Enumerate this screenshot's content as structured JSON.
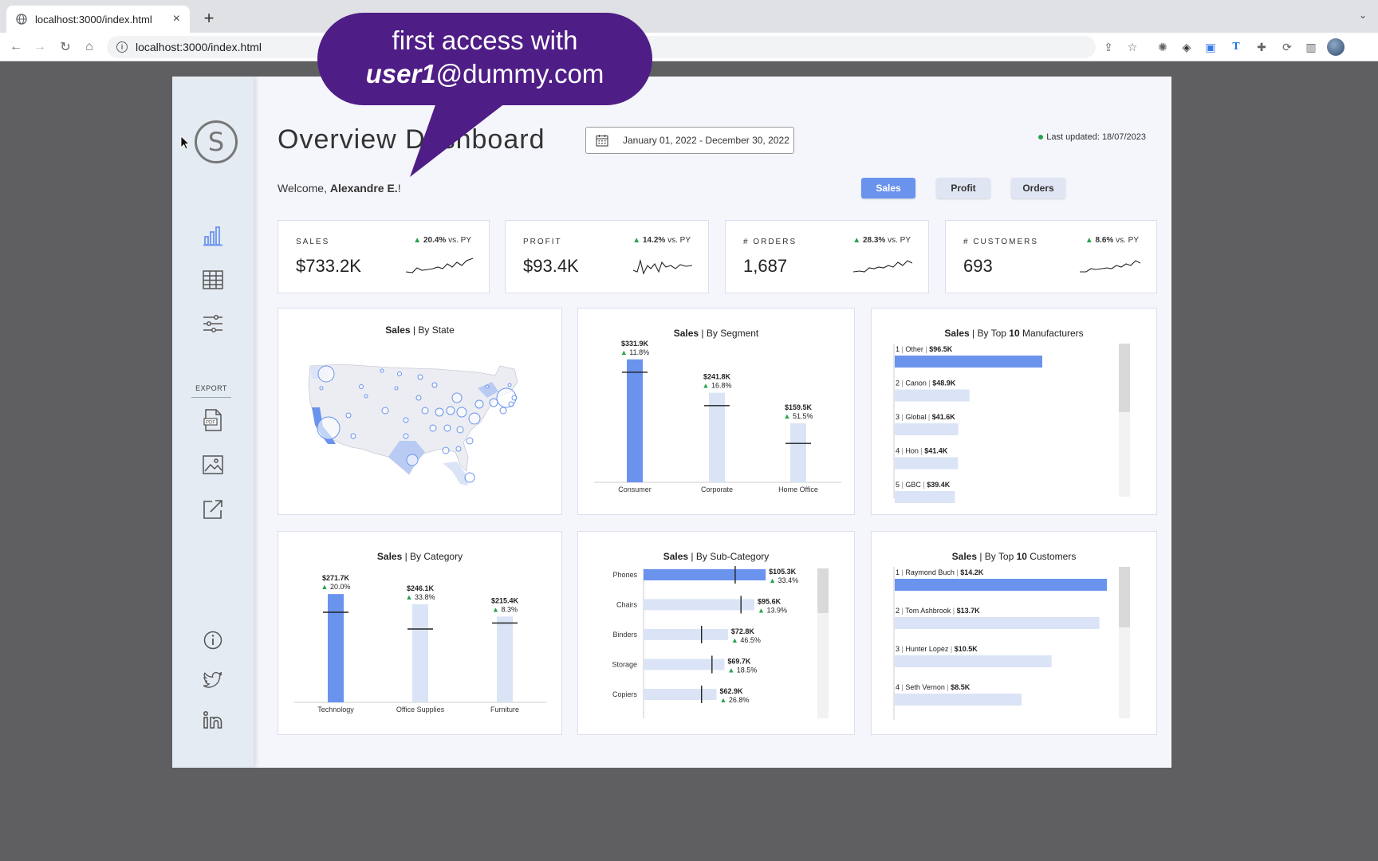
{
  "browser": {
    "tab_title": "localhost:3000/index.html",
    "tab_close": "×",
    "new_tab": "+",
    "url": "localhost:3000/index.html"
  },
  "callout": {
    "line1": "first access with",
    "user": "user1",
    "domain": "@dummy.com"
  },
  "sidebar": {
    "logo_letter": "S",
    "export_label": "EXPORT"
  },
  "header": {
    "title": "Overview Dashboard",
    "date_range": "January 01, 2022 - December 30, 2022",
    "last_updated": "Last updated: 18/07/2023",
    "welcome_prefix": "Welcome, ",
    "welcome_name": "Alexandre E.",
    "welcome_suffix": "!"
  },
  "metric_tabs": [
    "Sales",
    "Profit",
    "Orders"
  ],
  "kpis": [
    {
      "label": "SALES",
      "value": "$733.2K",
      "delta": "20.4%",
      "suffix": " vs. PY"
    },
    {
      "label": "PROFIT",
      "value": "$93.4K",
      "delta": "14.2%",
      "suffix": " vs. PY"
    },
    {
      "label": "# ORDERS",
      "value": "1,687",
      "delta": "28.3%",
      "suffix": " vs. PY"
    },
    {
      "label": "# CUSTOMERS",
      "value": "693",
      "delta": "8.6%",
      "suffix": " vs. PY"
    }
  ],
  "cards": {
    "state": {
      "measure": "Sales",
      "dim": " | By State"
    },
    "segment": {
      "measure": "Sales",
      "dim": " | By Segment"
    },
    "manufacturers": {
      "measure": "Sales",
      "dim_pre": " | By Top ",
      "n": "10",
      "dim_post": " Manufacturers"
    },
    "category": {
      "measure": "Sales",
      "dim": " | By Category"
    },
    "subcategory": {
      "measure": "Sales",
      "dim": " | By Sub-Category"
    },
    "customers": {
      "measure": "Sales",
      "dim_pre": " | By Top ",
      "n": "10",
      "dim_post": " Customers"
    }
  },
  "colors": {
    "highlight": "#6a93ee",
    "bar_light": "#dbe4f6",
    "up": "#27a24a",
    "callout": "#4f1d86"
  },
  "chart_data": [
    {
      "type": "bar",
      "id": "segment",
      "categories": [
        "Consumer",
        "Corporate",
        "Home Office"
      ],
      "values": [
        331.9,
        241.8,
        159.5
      ],
      "value_labels": [
        "$331.9K",
        "$241.8K",
        "$159.5K"
      ],
      "deltas": [
        "11.8%",
        "16.8%",
        "51.5%"
      ],
      "py_markers": [
        297,
        207,
        105
      ],
      "ymax": 340
    },
    {
      "type": "bar",
      "id": "category",
      "categories": [
        "Technology",
        "Office Supplies",
        "Furniture"
      ],
      "values": [
        271.7,
        246.1,
        215.4
      ],
      "value_labels": [
        "$271.7K",
        "$246.1K",
        "$215.4K"
      ],
      "deltas": [
        "20.0%",
        "33.8%",
        "8.3%"
      ],
      "py_markers": [
        226,
        184,
        199
      ],
      "ymax": 280
    },
    {
      "type": "bar",
      "id": "subcategory",
      "orientation": "horizontal",
      "categories": [
        "Phones",
        "Chairs",
        "Binders",
        "Storage",
        "Copiers"
      ],
      "values": [
        105.3,
        95.6,
        72.8,
        69.7,
        62.9
      ],
      "value_labels": [
        "$105.3K",
        "$95.6K",
        "$72.8K",
        "$69.7K",
        "$62.9K"
      ],
      "deltas": [
        "33.4%",
        "13.9%",
        "46.5%",
        "18.5%",
        "26.8%"
      ],
      "py_markers": [
        79,
        84,
        50,
        59,
        50
      ],
      "xmax": 110
    },
    {
      "type": "bar",
      "id": "manufacturers",
      "orientation": "horizontal",
      "ranks": [
        "1",
        "2",
        "3",
        "4",
        "5"
      ],
      "categories": [
        "Other",
        "Canon",
        "Global",
        "Hon",
        "GBC"
      ],
      "values": [
        96.5,
        48.9,
        41.6,
        41.4,
        39.4
      ],
      "value_labels": [
        "$96.5K",
        "$48.9K",
        "$41.6K",
        "$41.4K",
        "$39.4K"
      ],
      "xmax": 96.5
    },
    {
      "type": "bar",
      "id": "customers",
      "orientation": "horizontal",
      "ranks": [
        "1",
        "2",
        "3",
        "4"
      ],
      "categories": [
        "Raymond Buch",
        "Tom Ashbrook",
        "Hunter Lopez",
        "Seth Vernon"
      ],
      "values": [
        14.2,
        13.7,
        10.5,
        8.5
      ],
      "value_labels": [
        "$14.2K",
        "$13.7K",
        "$10.5K",
        "$8.5K"
      ],
      "xmax": 14.2
    }
  ]
}
